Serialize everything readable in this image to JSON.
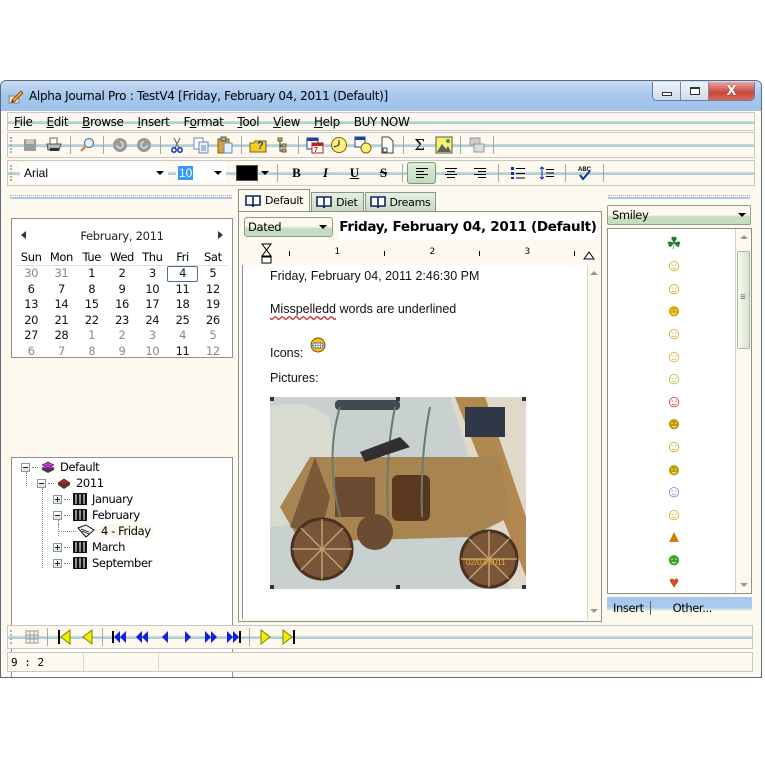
{
  "window": {
    "title": "Alpha Journal Pro : TestV4 [Friday, February 04, 2011 (Default)]",
    "controls": [
      "minimize",
      "maximize",
      "close"
    ]
  },
  "menubar": [
    {
      "label": "File",
      "accel": "F"
    },
    {
      "label": "Edit",
      "accel": "E"
    },
    {
      "label": "Browse",
      "accel": "B"
    },
    {
      "label": "Insert",
      "accel": "I"
    },
    {
      "label": "Format",
      "accel": "o"
    },
    {
      "label": "Tool",
      "accel": "T"
    },
    {
      "label": "View",
      "accel": "V"
    },
    {
      "label": "Help",
      "accel": "H"
    },
    {
      "label": "BUY NOW",
      "accel": ""
    }
  ],
  "toolbar": {
    "buttons": [
      "save-icon",
      "print-icon",
      "find-icon",
      "undo-icon",
      "redo-icon",
      "cut-icon",
      "copy-icon",
      "paste-icon",
      "password-icon",
      "tree-icon",
      "calendar-icon",
      "clock-icon",
      "date-time-icon",
      "new-page-icon",
      "sum-icon",
      "picture-icon",
      "window-icon"
    ]
  },
  "format_toolbar": {
    "font": "Arial",
    "size": "10",
    "color": "#000000",
    "bold": "B",
    "italic": "I",
    "underline": "U",
    "strike": "S",
    "alignment": "left"
  },
  "calendar": {
    "month_label": "February, 2011",
    "days_of_week": [
      "Sun",
      "Mon",
      "Tue",
      "Wed",
      "Thu",
      "Fri",
      "Sat"
    ],
    "weeks": [
      [
        {
          "d": "30",
          "o": true
        },
        {
          "d": "31",
          "o": true
        },
        {
          "d": "1"
        },
        {
          "d": "2"
        },
        {
          "d": "3"
        },
        {
          "d": "4",
          "sel": true
        },
        {
          "d": "5"
        }
      ],
      [
        {
          "d": "6"
        },
        {
          "d": "7"
        },
        {
          "d": "8"
        },
        {
          "d": "9"
        },
        {
          "d": "10"
        },
        {
          "d": "11"
        },
        {
          "d": "12"
        }
      ],
      [
        {
          "d": "13"
        },
        {
          "d": "14"
        },
        {
          "d": "15"
        },
        {
          "d": "16"
        },
        {
          "d": "17"
        },
        {
          "d": "18"
        },
        {
          "d": "19"
        }
      ],
      [
        {
          "d": "20"
        },
        {
          "d": "21"
        },
        {
          "d": "22"
        },
        {
          "d": "23"
        },
        {
          "d": "24"
        },
        {
          "d": "25"
        },
        {
          "d": "26"
        }
      ],
      [
        {
          "d": "27"
        },
        {
          "d": "28"
        },
        {
          "d": "1",
          "o": true
        },
        {
          "d": "2",
          "o": true
        },
        {
          "d": "3",
          "o": true
        },
        {
          "d": "4",
          "o": true
        },
        {
          "d": "5",
          "o": true
        }
      ],
      [
        {
          "d": "6",
          "o": true
        },
        {
          "d": "7",
          "o": true
        },
        {
          "d": "8",
          "o": true
        },
        {
          "d": "9",
          "o": true
        },
        {
          "d": "10",
          "o": true
        },
        {
          "d": "11"
        },
        {
          "d": "12",
          "o": true
        }
      ]
    ]
  },
  "tree": {
    "root": "Default",
    "year": "2011",
    "months": [
      "January",
      "February",
      "March",
      "September"
    ],
    "entry": "4 - Friday",
    "add_label": "+",
    "remove_label": "−"
  },
  "tabs": [
    {
      "label": "Default",
      "active": true
    },
    {
      "label": "Diet"
    },
    {
      "label": "Dreams"
    }
  ],
  "editor": {
    "view_mode": "Dated",
    "entry_title": "Friday, February 04, 2011 (Default)",
    "ruler_labels": [
      "1",
      "2",
      "3"
    ],
    "timestamp": "Friday, February 04, 2011 2:46:30 PM",
    "misspelled_word": "Misspelledd",
    "line2_rest": " words are underlined",
    "icons_label": "Icons:",
    "pictures_label": "Pictures:",
    "photo_date_stamp": "02/03/2011"
  },
  "smiley_panel": {
    "category": "Smiley",
    "items": [
      "clover",
      "thinking",
      "laughing",
      "grin",
      "confused",
      "blush",
      "idea",
      "clown",
      "cool",
      "sick",
      "crying",
      "devil",
      "sleepy",
      "warning",
      "frog",
      "heart"
    ],
    "insert_label": "Insert",
    "other_label": "Other..."
  },
  "nav_toolbar": [
    "grid-icon",
    "first-page-icon",
    "previous-page-icon",
    "first-entry-icon",
    "fast-back-icon",
    "previous-entry-icon",
    "next-entry-icon",
    "fast-forward-icon",
    "last-entry-icon",
    "next-page-icon",
    "last-page-icon"
  ],
  "statusbar": {
    "position": "9 : 2"
  }
}
